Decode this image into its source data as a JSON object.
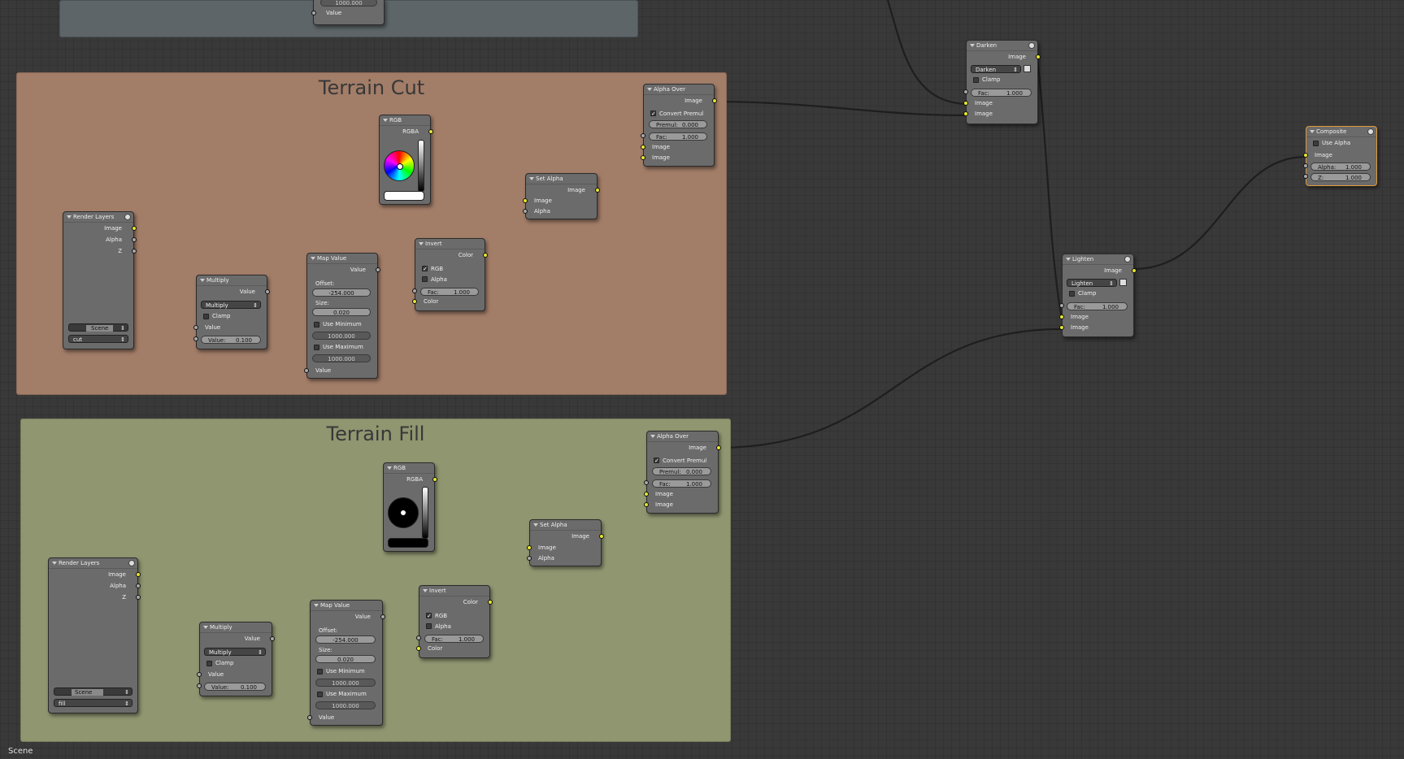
{
  "editor": {
    "name": "Scene"
  },
  "frames": [
    {
      "title": "Terrain Cut",
      "color": "#a27d68"
    },
    {
      "title": "Terrain Fill",
      "color": "#8f9670"
    }
  ],
  "top_group": {
    "value_label": "Value",
    "max_value": "1000.000"
  },
  "cut": {
    "render_layers": {
      "title": "Render Layers",
      "outputs": [
        "Image",
        "Alpha",
        "Z"
      ],
      "scene": "Scene",
      "layer": "cut"
    },
    "multiply": {
      "title": "Multiply",
      "output": "Value",
      "mode": "Multiply",
      "clamp": "Clamp",
      "input": "Value",
      "value_label": "Value:",
      "value": "0.100"
    },
    "map_value": {
      "title": "Map Value",
      "output": "Value",
      "offset_label": "Offset:",
      "offset": "-254.000",
      "size_label": "Size:",
      "size": "0.020",
      "use_min": "Use Minimum",
      "min": "1000.000",
      "use_max": "Use Maximum",
      "max": "1000.000",
      "input": "Value"
    },
    "rgb": {
      "title": "RGB",
      "output": "RGBA",
      "swatch": "#ffffff"
    },
    "invert": {
      "title": "Invert",
      "output": "Color",
      "rgb": "RGB",
      "alpha": "Alpha",
      "fac_label": "Fac:",
      "fac": "1.000",
      "input": "Color"
    },
    "set_alpha": {
      "title": "Set Alpha",
      "output": "Image",
      "in1": "Image",
      "in2": "Alpha"
    },
    "alpha_over": {
      "title": "Alpha Over",
      "output": "Image",
      "convert": "Convert Premul",
      "premul_label": "Premul:",
      "premul": "0.000",
      "fac_label": "Fac:",
      "fac": "1.000",
      "in1": "Image",
      "in2": "Image"
    }
  },
  "fill": {
    "render_layers": {
      "title": "Render Layers",
      "outputs": [
        "Image",
        "Alpha",
        "Z"
      ],
      "scene": "Scene",
      "layer": "fill"
    },
    "multiply": {
      "title": "Multiply",
      "output": "Value",
      "mode": "Multiply",
      "clamp": "Clamp",
      "input": "Value",
      "value_label": "Value:",
      "value": "0.100"
    },
    "map_value": {
      "title": "Map Value",
      "output": "Value",
      "offset_label": "Offset:",
      "offset": "-254.000",
      "size_label": "Size:",
      "size": "0.020",
      "use_min": "Use Minimum",
      "min": "1000.000",
      "use_max": "Use Maximum",
      "max": "1000.000",
      "input": "Value"
    },
    "rgb": {
      "title": "RGB",
      "output": "RGBA",
      "swatch": "#000000"
    },
    "invert": {
      "title": "Invert",
      "output": "Color",
      "rgb": "RGB",
      "alpha": "Alpha",
      "fac_label": "Fac:",
      "fac": "1.000",
      "input": "Color"
    },
    "set_alpha": {
      "title": "Set Alpha",
      "output": "Image",
      "in1": "Image",
      "in2": "Alpha"
    },
    "alpha_over": {
      "title": "Alpha Over",
      "output": "Image",
      "convert": "Convert Premul",
      "premul_label": "Premul:",
      "premul": "0.000",
      "fac_label": "Fac:",
      "fac": "1.000",
      "in1": "Image",
      "in2": "Image"
    }
  },
  "darken": {
    "title": "Darken",
    "output": "Image",
    "mode": "Darken",
    "clamp": "Clamp",
    "fac_label": "Fac:",
    "fac": "1.000",
    "in1": "Image",
    "in2": "Image"
  },
  "lighten": {
    "title": "Lighten",
    "output": "Image",
    "mode": "Lighten",
    "clamp": "Clamp",
    "fac_label": "Fac:",
    "fac": "1.000",
    "in1": "Image",
    "in2": "Image"
  },
  "composite": {
    "title": "Composite",
    "use_alpha": "Use Alpha",
    "input": "Image",
    "alpha_label": "Alpha:",
    "alpha": "1.000",
    "z_label": "Z:",
    "z": "1.000"
  },
  "colors": {
    "frame_cut": "#a27d68",
    "frame_fill": "#8f9670",
    "top_frame": "#5d6568",
    "socket_image": "#e6e62e",
    "socket_value": "#a8a8a8",
    "wire": "#1e1e1e",
    "composite_border": "#e09a3a"
  }
}
